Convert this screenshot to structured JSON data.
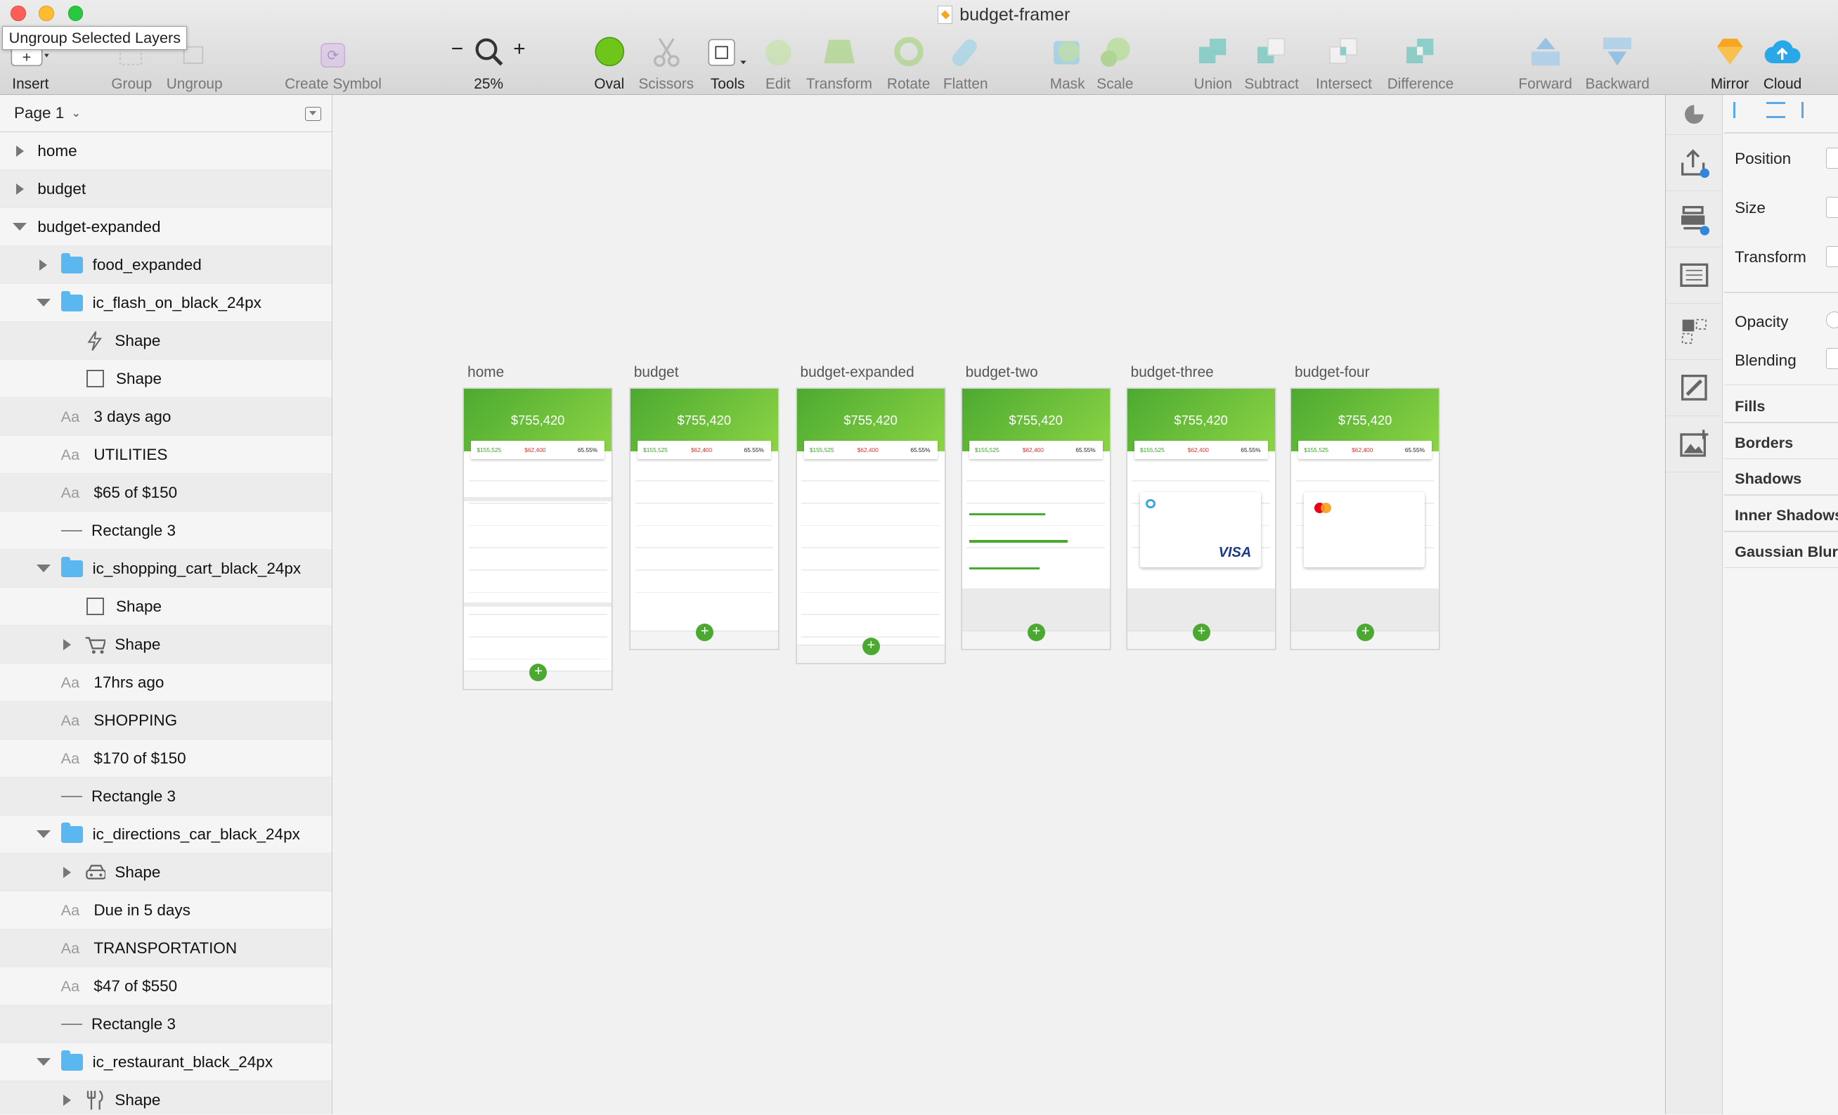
{
  "window": {
    "title": "budget-framer",
    "tooltip": "Ungroup Selected Layers"
  },
  "toolbar": {
    "insert": "Insert",
    "group": "Group",
    "ungroup": "Ungroup",
    "create_symbol": "Create Symbol",
    "zoom_value": "25%",
    "oval": "Oval",
    "scissors": "Scissors",
    "tools": "Tools",
    "edit": "Edit",
    "transform": "Transform",
    "rotate": "Rotate",
    "flatten": "Flatten",
    "mask": "Mask",
    "scale": "Scale",
    "union": "Union",
    "subtract": "Subtract",
    "intersect": "Intersect",
    "difference": "Difference",
    "forward": "Forward",
    "backward": "Backward",
    "mirror": "Mirror",
    "cloud": "Cloud",
    "zoom_minus": "−",
    "zoom_plus": "+"
  },
  "sidebar": {
    "page": "Page 1",
    "layers": [
      {
        "name": "home",
        "kind": "group",
        "indent": 0,
        "arrow": "right"
      },
      {
        "name": "budget",
        "kind": "group",
        "indent": 0,
        "arrow": "right"
      },
      {
        "name": "budget-expanded",
        "kind": "group",
        "indent": 0,
        "arrow": "down"
      },
      {
        "name": "food_expanded",
        "kind": "folder",
        "indent": 1,
        "arrow": "right"
      },
      {
        "name": "ic_flash_on_black_24px",
        "kind": "folder",
        "indent": 1,
        "arrow": "down"
      },
      {
        "name": "Shape",
        "kind": "flash",
        "indent": 2,
        "arrow": ""
      },
      {
        "name": "Shape",
        "kind": "square",
        "indent": 2,
        "arrow": ""
      },
      {
        "name": "3 days ago",
        "kind": "text",
        "indent": 1,
        "arrow": ""
      },
      {
        "name": "UTILITIES",
        "kind": "text",
        "indent": 1,
        "arrow": ""
      },
      {
        "name": "$65 of $150",
        "kind": "text",
        "indent": 1,
        "arrow": ""
      },
      {
        "name": "Rectangle 3",
        "kind": "line",
        "indent": 1,
        "arrow": ""
      },
      {
        "name": "ic_shopping_cart_black_24px",
        "kind": "folder",
        "indent": 1,
        "arrow": "down"
      },
      {
        "name": "Shape",
        "kind": "square",
        "indent": 2,
        "arrow": ""
      },
      {
        "name": "Shape",
        "kind": "cart",
        "indent": 2,
        "arrow": "right"
      },
      {
        "name": "17hrs ago",
        "kind": "text",
        "indent": 1,
        "arrow": ""
      },
      {
        "name": "SHOPPING",
        "kind": "text",
        "indent": 1,
        "arrow": ""
      },
      {
        "name": "$170 of $150",
        "kind": "text",
        "indent": 1,
        "arrow": ""
      },
      {
        "name": "Rectangle 3",
        "kind": "line",
        "indent": 1,
        "arrow": ""
      },
      {
        "name": "ic_directions_car_black_24px",
        "kind": "folder",
        "indent": 1,
        "arrow": "down"
      },
      {
        "name": "Shape",
        "kind": "car",
        "indent": 2,
        "arrow": "right"
      },
      {
        "name": "Due in 5 days",
        "kind": "text",
        "indent": 1,
        "arrow": ""
      },
      {
        "name": "TRANSPORTATION",
        "kind": "text",
        "indent": 1,
        "arrow": ""
      },
      {
        "name": "$47 of $550",
        "kind": "text",
        "indent": 1,
        "arrow": ""
      },
      {
        "name": "Rectangle 3",
        "kind": "line",
        "indent": 1,
        "arrow": ""
      },
      {
        "name": "ic_restaurant_black_24px",
        "kind": "folder",
        "indent": 1,
        "arrow": "down"
      },
      {
        "name": "Shape",
        "kind": "fork",
        "indent": 2,
        "arrow": "right"
      }
    ]
  },
  "artboards": [
    {
      "label": "home",
      "amount": "$755,420",
      "g": "$155,525",
      "r": "$62,400",
      "k": "65.55%"
    },
    {
      "label": "budget",
      "amount": "$755,420",
      "g": "$155,525",
      "r": "$62,400",
      "k": "65.55%"
    },
    {
      "label": "budget-expanded",
      "amount": "$755,420",
      "g": "$155,525",
      "r": "$62,400",
      "k": "65.55%"
    },
    {
      "label": "budget-two",
      "amount": "$755,420",
      "g": "$155,525",
      "r": "$62,400",
      "k": "65.55%"
    },
    {
      "label": "budget-three",
      "amount": "$755,420",
      "g": "$155,525",
      "r": "$62,400",
      "k": "65.55%"
    },
    {
      "label": "budget-four",
      "amount": "$755,420",
      "g": "$155,525",
      "r": "$62,400",
      "k": "65.55%"
    }
  ],
  "inspector": {
    "position": "Position",
    "size": "Size",
    "transform": "Transform",
    "opacity": "Opacity",
    "blending": "Blending",
    "fills": "Fills",
    "borders": "Borders",
    "shadows": "Shadows",
    "inner_shadows": "Inner Shadows",
    "gaussian_blur": "Gaussian Blur"
  },
  "colors": {
    "accent_green": "#4ba830",
    "brand_blue": "#5bb7ef",
    "sketch_orange": "#f6a623"
  }
}
